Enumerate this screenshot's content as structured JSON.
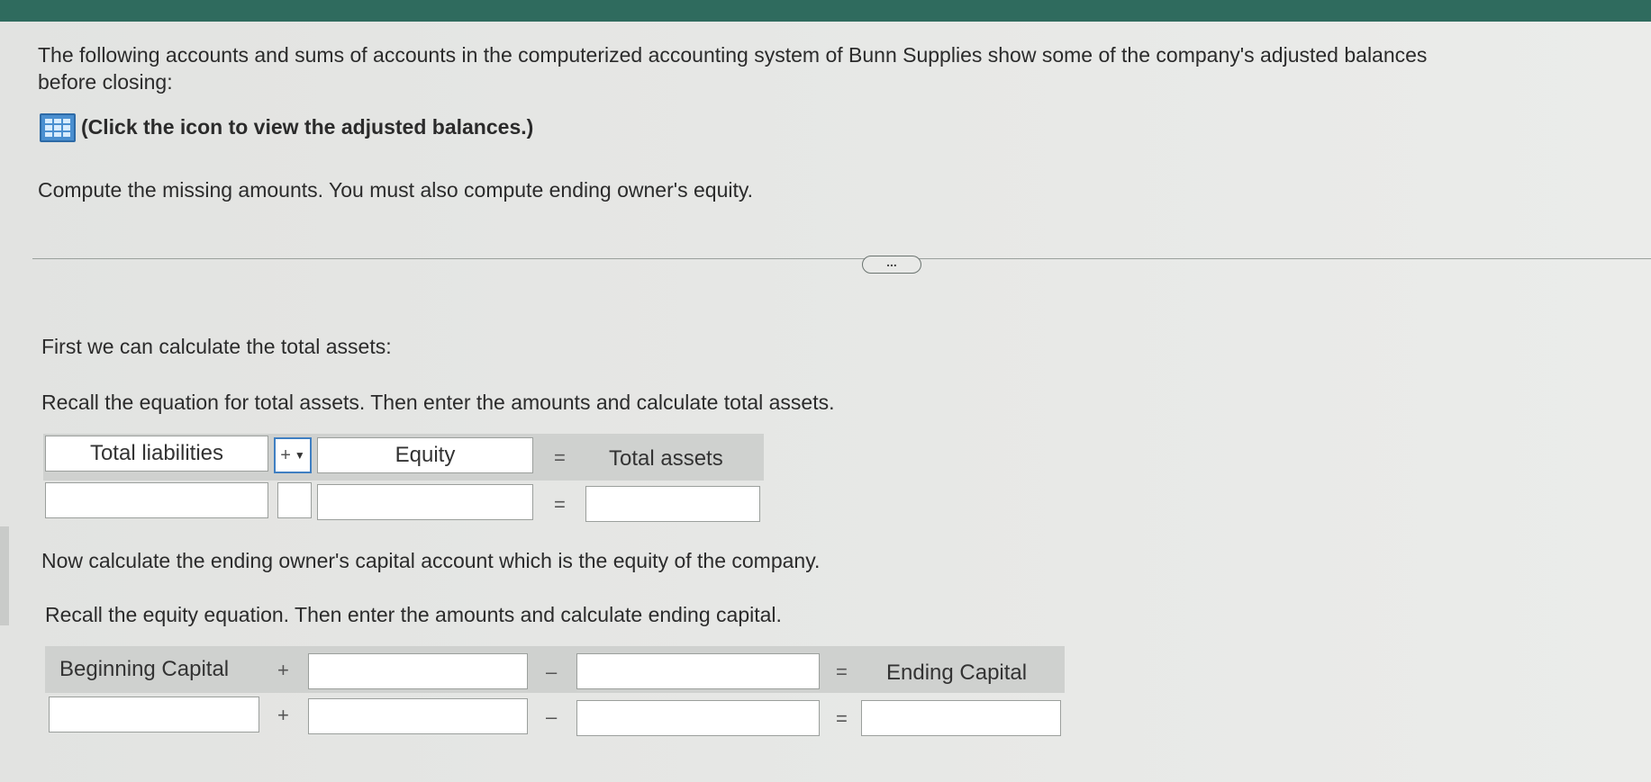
{
  "intro": {
    "line1": "The following accounts and sums of accounts in the computerized accounting system of Bunn Supplies show some of the company's adjusted balances",
    "line2": "before closing:",
    "icon_link": "(Click the icon to view the adjusted balances.)",
    "instruction": "Compute the missing amounts. You must also compute ending owner's equity."
  },
  "more_button": "...",
  "section1": {
    "heading": "First we can calculate the total assets:",
    "prompt": "Recall the equation for total assets. Then enter the amounts and calculate total assets.",
    "label_left": "Total liabilities",
    "operator_select": "+",
    "label_middle": "Equity",
    "equals": "=",
    "label_right": "Total assets"
  },
  "section2": {
    "heading": "Now calculate the ending owner's capital account which is the equity of the company.",
    "prompt": "Recall the equity equation. Then enter the amounts and calculate ending capital.",
    "label_left": "Beginning Capital",
    "plus": "+",
    "minus": "–",
    "equals": "=",
    "label_right": "Ending Capital"
  },
  "colors": {
    "topbar": "#2f6b5e",
    "icon": "#4a8fd0",
    "select_border": "#3f7fc2"
  },
  "icons": {
    "balances_icon": "grid-table-icon",
    "select_arrow": "caret-down-icon"
  }
}
